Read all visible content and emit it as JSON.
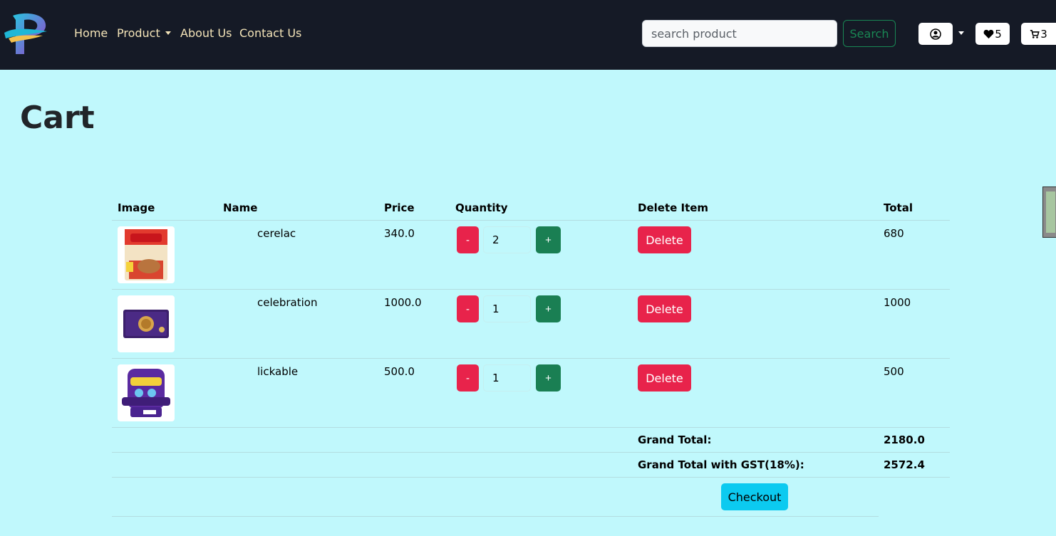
{
  "nav": {
    "links": [
      "Home",
      "Product",
      "About Us",
      "Contact Us"
    ],
    "search_placeholder": "search product",
    "search_label": "Search",
    "wishlist_count": "5",
    "cart_count": "3"
  },
  "page": {
    "title": "Cart"
  },
  "table": {
    "headers": [
      "Image",
      "Name",
      "Price",
      "Quantity",
      "Delete Item",
      "Total"
    ],
    "rows": [
      {
        "name": "cerelac",
        "price": "340.0",
        "quantity": "2",
        "total": "680",
        "delete_label": "Delete",
        "minus": "-",
        "plus": "+"
      },
      {
        "name": "celebration",
        "price": "1000.0",
        "quantity": "1",
        "total": "1000",
        "delete_label": "Delete",
        "minus": "-",
        "plus": "+"
      },
      {
        "name": "lickable",
        "price": "500.0",
        "quantity": "1",
        "total": "500",
        "delete_label": "Delete",
        "minus": "-",
        "plus": "+"
      }
    ],
    "grand_total_label": "Grand Total:",
    "grand_total": "2180.0",
    "gst_total_label": "Grand Total with GST(18%):",
    "gst_total": "2572.4",
    "checkout_label": "Checkout"
  },
  "colors": {
    "navbar": "#151a26",
    "page_bg": "#c0f8fc",
    "danger": "#e8234b",
    "success": "#1a7f53",
    "info": "#0ccaf0"
  }
}
